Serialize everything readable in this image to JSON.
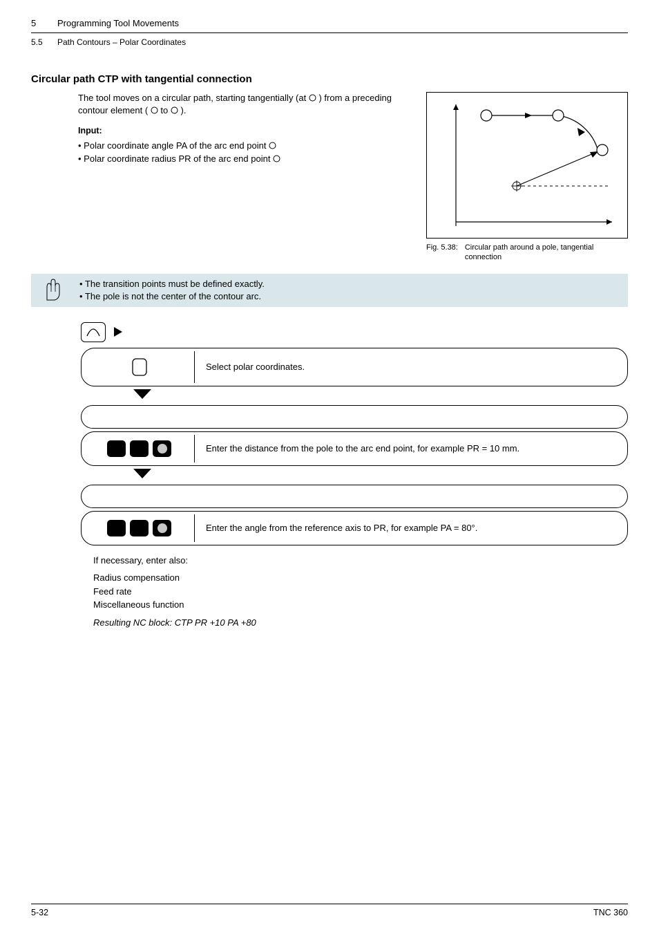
{
  "header": {
    "chapter_number": "5",
    "chapter_title": "Programming Tool Movements",
    "section_number": "5.5",
    "section_title": "Path Contours – Polar Coordinates"
  },
  "section_heading": "Circular path CTP with tangential connection",
  "intro_part1": "The tool moves on a circular path, starting tangentially (at ",
  "intro_part2": ") from a preceding contour element (",
  "intro_part3": " to ",
  "intro_part4": ").",
  "input_label": "Input:",
  "input_items": [
    "Polar coordinate angle PA of the arc end point ",
    "Polar coordinate radius PR of the arc end point "
  ],
  "figure": {
    "number": "Fig. 5.38:",
    "caption": "Circular path around a pole, tangential connection"
  },
  "note_items": [
    "The transition points must be defined exactly.",
    "The pole is not the center of the contour arc."
  ],
  "steps": {
    "step1": "Select polar coordinates.",
    "step2": "Enter the distance from the pole to the arc end point, for example PR = 10 mm.",
    "step3": "Enter the angle from the reference axis to PR, for example PA = 80°."
  },
  "after": {
    "line1": "If necessary, enter also:",
    "line2": "Radius compensation",
    "line3": "Feed rate",
    "line4": "Miscellaneous function",
    "resulting": "Resulting NC block: CTP PR +10  PA +80"
  },
  "footer": {
    "left": "5-32",
    "right": "TNC 360"
  }
}
